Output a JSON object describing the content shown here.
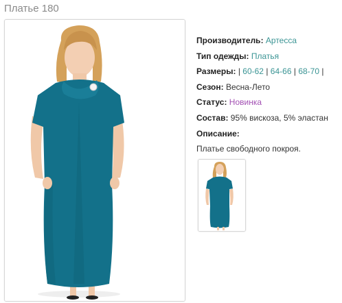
{
  "product": {
    "title": "Платье 180"
  },
  "details": {
    "manufacturer_label": "Производитель:",
    "manufacturer_value": "Артесса",
    "clothing_type_label": "Тип одежды:",
    "clothing_type_value": "Платья",
    "sizes_label": "Размеры:",
    "sizes_sep": "|",
    "sizes": [
      "60-62",
      "64-66",
      "68-70"
    ],
    "season_label": "Сезон:",
    "season_value": "Весна-Лето",
    "status_label": "Статус:",
    "status_value": "Новинка",
    "composition_label": "Состав:",
    "composition_value": "95% вискоза, 5% эластан",
    "description_label": "Описание:",
    "description_value": "Платье свободного покроя."
  },
  "colors": {
    "link": "#3a9494",
    "status": "#a24fb3",
    "dress": "#13718a",
    "title": "#8a8a8a"
  }
}
